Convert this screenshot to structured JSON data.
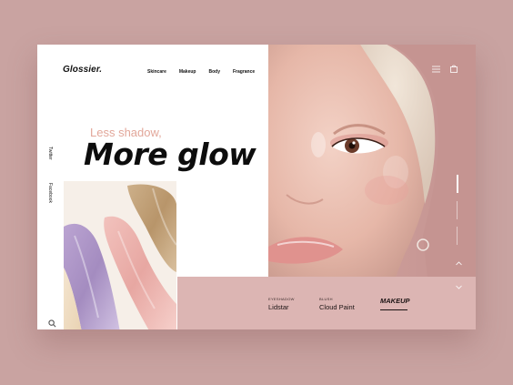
{
  "brand": {
    "logo": "Glossier."
  },
  "nav": {
    "items": [
      "Skincare",
      "Makeup",
      "Body",
      "Fragrance"
    ]
  },
  "social": {
    "twitter": "Twitter",
    "facebook": "Facebook"
  },
  "hero": {
    "tagline": "Less shadow,",
    "headline": "More glow"
  },
  "products": [
    {
      "category": "EYESHADOW",
      "name": "Lidstar"
    },
    {
      "category": "BLUSH",
      "name": "Cloud Paint"
    }
  ],
  "active_tab": {
    "label": "MAKEUP"
  },
  "icons": {
    "search": "search-icon",
    "menu": "menu-icon",
    "bag": "bag-icon",
    "up": "chevron-up-icon",
    "down": "chevron-down-icon"
  },
  "colors": {
    "background": "#c9a3a1",
    "accent_text": "#e2a79a",
    "panel": "#dcb5b3"
  }
}
